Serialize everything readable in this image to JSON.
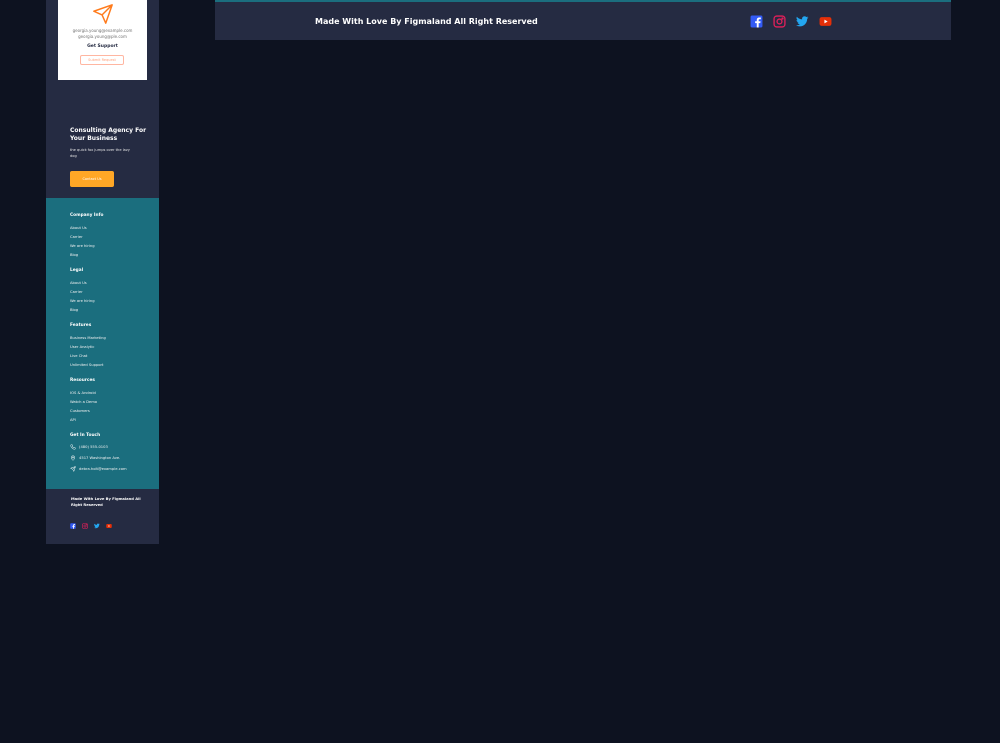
{
  "card": {
    "email1": "georgia.young@example.com",
    "email2": "georgia.young@ple.com",
    "support": "Get Support",
    "submit": "Submit Request"
  },
  "hero": {
    "title": "Consulting Agency For Your Business",
    "text": "the quick fox jumps over the lazy dog",
    "button": "Contact Us"
  },
  "footer_links": {
    "company": {
      "title": "Company Info",
      "items": [
        "About Us",
        "Carrier",
        "We are hiring",
        "Blog"
      ]
    },
    "legal": {
      "title": "Legal",
      "items": [
        "About Us",
        "Carrier",
        "We are hiring",
        "Blog"
      ]
    },
    "features": {
      "title": "Features",
      "items": [
        "Business Marketing",
        "User Analytic",
        "Live Chat",
        "Unlimited Support"
      ]
    },
    "resources": {
      "title": "Resources",
      "items": [
        "IOS & Android",
        "Watch a Demo",
        "Customers",
        "API"
      ]
    },
    "touch": {
      "title": "Get In Touch",
      "phone": "(480) 555-0103",
      "address": "4517 Washington Ave.",
      "email": "debra.holt@example.com"
    }
  },
  "mobile_footer": {
    "text": "Made With Love By Figmaland All Right Reserved"
  },
  "desktop_footer": {
    "text": "Made With Love By Figmaland All Right Reserved"
  },
  "social": {
    "facebook": "#335BF5",
    "instagram": "#E51F5A",
    "twitter": "#23A6F0",
    "youtube": "#E42F08"
  }
}
